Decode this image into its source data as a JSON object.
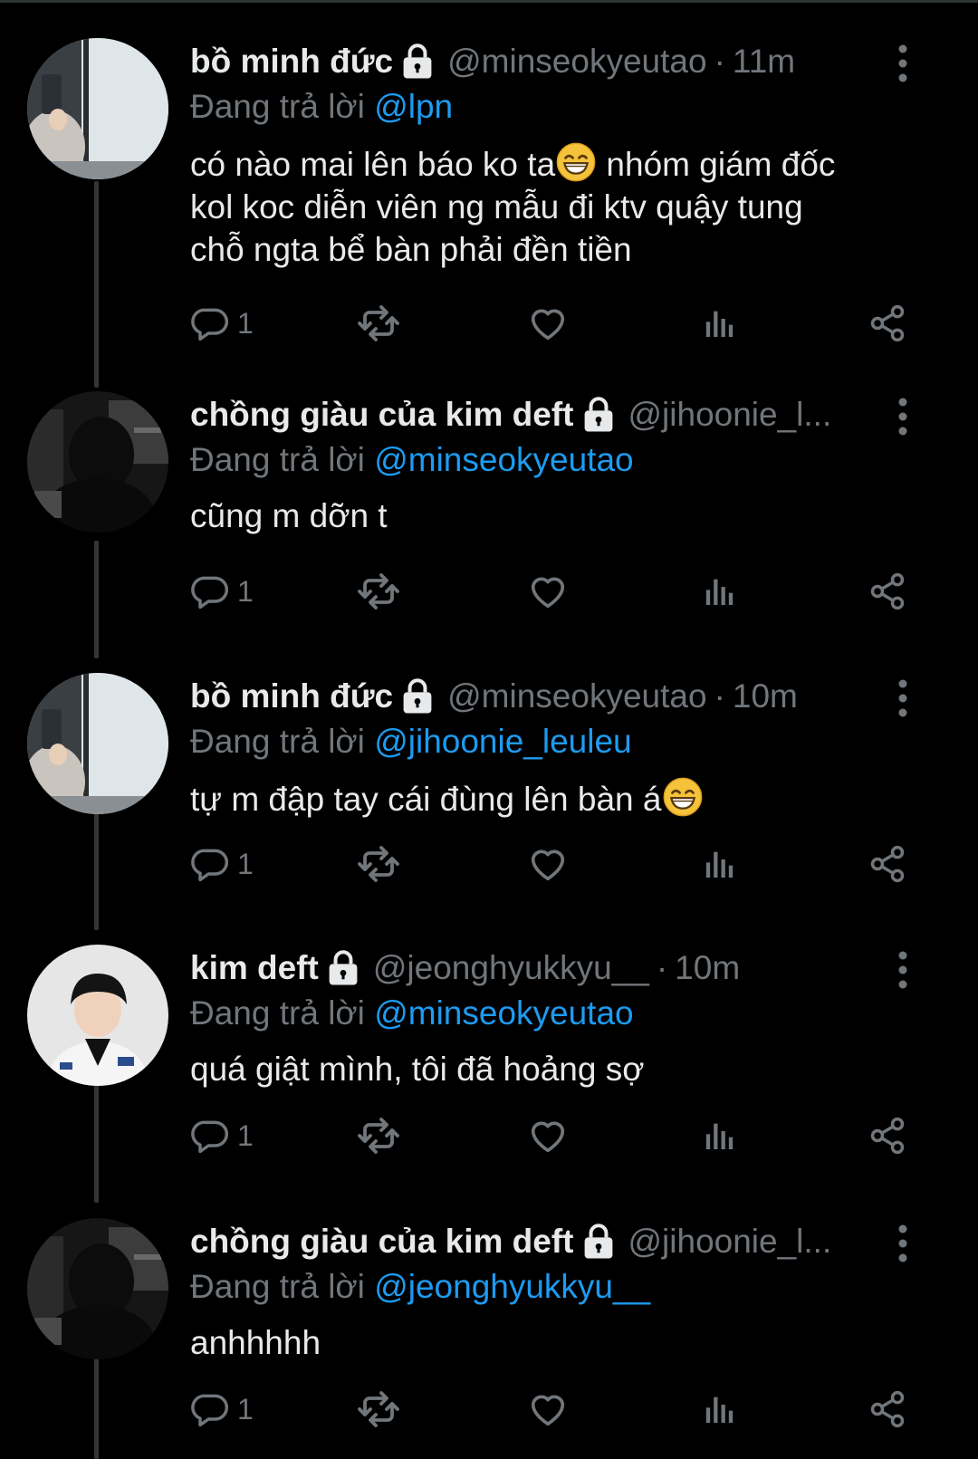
{
  "reply_prefix": "Đang trả lời",
  "tweets": [
    {
      "display_name": "bồ minh đức",
      "handle": "@minseokyeutao",
      "dot": "·",
      "time": "11m",
      "reply_to": "@lpn",
      "text_parts": [
        "có nào mai lên báo ko ta",
        " nhóm giám đốc\nkol koc diễn viên ng mẫu đi ktv quậy tung\nchỗ ngta bể bàn phải đền tiền"
      ],
      "emoji": "grinning-face-emoji",
      "reply_count": "1"
    },
    {
      "display_name": "chồng giàu của kim deft",
      "handle": "@jihoonie_l...",
      "dot": "",
      "time": "",
      "reply_to": "@minseokyeutao",
      "text_parts": [
        "cũng m dỡn t"
      ],
      "reply_count": "1"
    },
    {
      "display_name": "bồ minh đức",
      "handle": "@minseokyeutao",
      "dot": "·",
      "time": "10m",
      "reply_to": "@jihoonie_leuleu",
      "text_parts": [
        "tự m đập tay cái đùng lên bàn á"
      ],
      "emoji": "grinning-face-emoji",
      "reply_count": "1"
    },
    {
      "display_name": "kim deft",
      "handle": "@jeonghyukkyu__",
      "dot": "·",
      "time": "10m",
      "reply_to": "@minseokyeutao",
      "text_parts": [
        "quá giật mình, tôi đã hoảng sợ"
      ],
      "reply_count": "1"
    },
    {
      "display_name": "chồng giàu của kim deft",
      "handle": "@jihoonie_l...",
      "dot": "",
      "time": "",
      "reply_to": "@jeonghyukkyu__",
      "text_parts": [
        "anhhhhh"
      ],
      "reply_count": "1"
    }
  ],
  "icons": {
    "reply": "reply-icon",
    "retweet": "retweet-icon",
    "like": "heart-icon",
    "views": "analytics-icon",
    "share": "share-icon",
    "more": "more-vertical-icon",
    "protected": "lock-icon"
  },
  "colors": {
    "background": "#000000",
    "primary_text": "#e7e9ea",
    "secondary_text": "#71767b",
    "mention": "#1d9bf0",
    "thread_line": "#333639"
  }
}
